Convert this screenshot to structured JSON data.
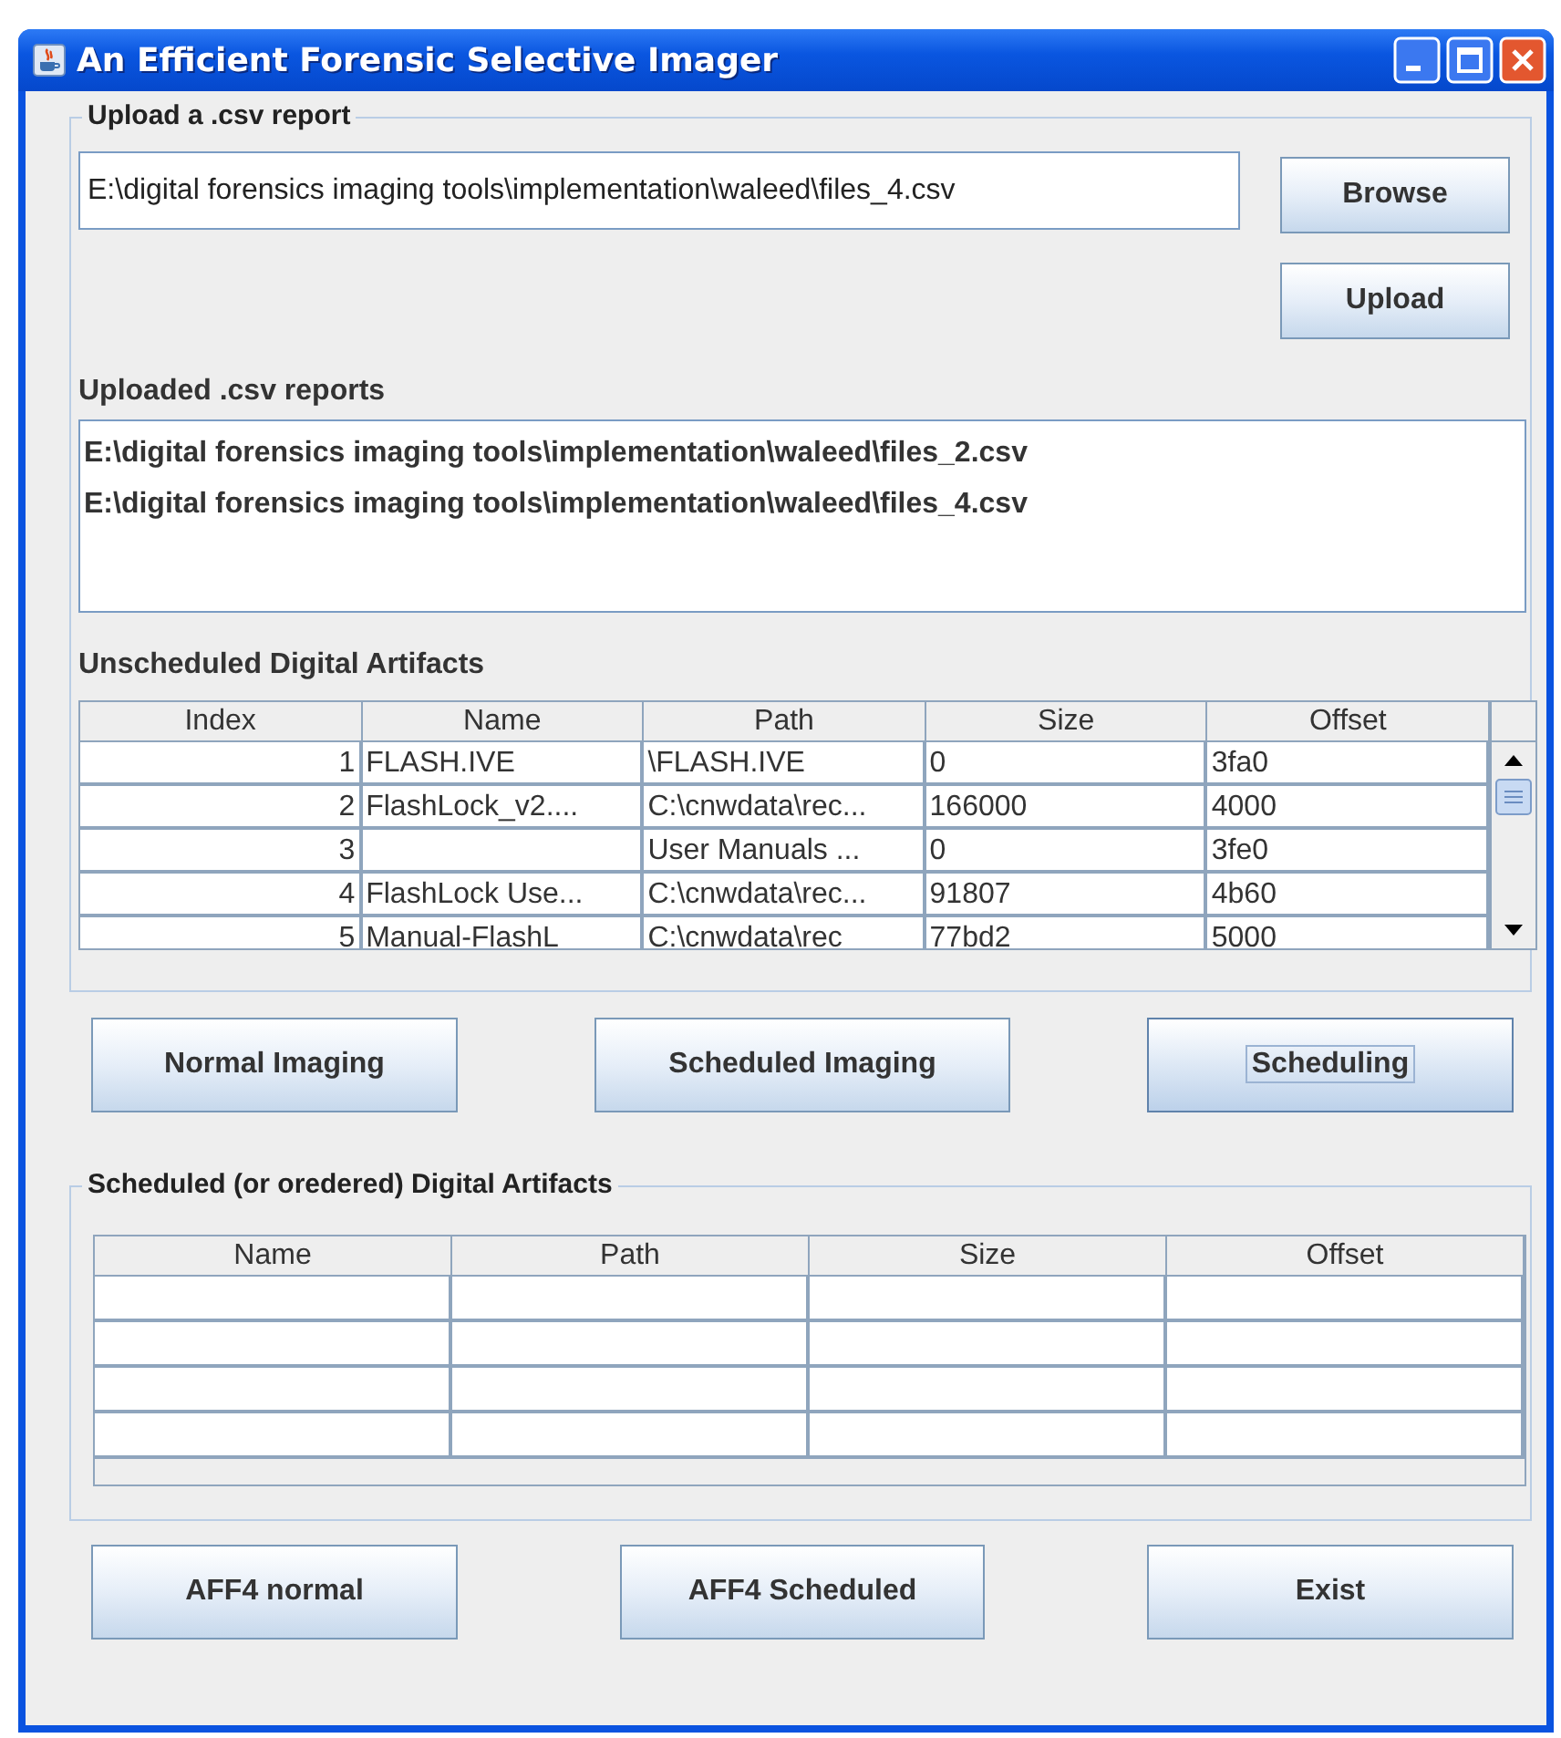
{
  "window": {
    "title": "An Efficient Forensic Selective Imager"
  },
  "upload": {
    "legend": "Upload a .csv report",
    "file_field": {
      "value": "E:\\digital forensics imaging tools\\implementation\\waleed\\files_4.csv"
    },
    "buttons": [
      {
        "label": "Browse"
      },
      {
        "label": "Upload"
      }
    ],
    "reports_label": "Uploaded .csv reports",
    "reports": [
      "E:\\digital forensics imaging tools\\implementation\\waleed\\files_2.csv",
      "E:\\digital forensics imaging tools\\implementation\\waleed\\files_4.csv"
    ],
    "unscheduled_label": "Unscheduled Digital Artifacts",
    "unscheduled_table": {
      "columns": [
        "Index",
        "Name",
        "Path",
        "Size",
        "Offset"
      ],
      "rows": [
        [
          "1",
          "FLASH.IVE",
          "\\FLASH.IVE",
          "0",
          "3fa0"
        ],
        [
          "2",
          "FlashLock_v2....",
          "C:\\cnwdata\\rec...",
          "166000",
          "4000"
        ],
        [
          "3",
          "",
          "User Manuals ...",
          "0",
          "3fe0"
        ],
        [
          "4",
          "FlashLock Use...",
          "C:\\cnwdata\\rec...",
          "91807",
          "4b60"
        ],
        [
          "5",
          "Manual-FlashL",
          "C:\\cnwdata\\rec",
          "77bd2",
          "5000"
        ]
      ]
    }
  },
  "actions": [
    {
      "label": "Normal Imaging",
      "focused": false
    },
    {
      "label": "Scheduled Imaging",
      "focused": false
    },
    {
      "label": "Scheduling",
      "focused": true
    }
  ],
  "scheduled": {
    "legend": "Scheduled (or oredered) Digital Artifacts",
    "table": {
      "columns": [
        "Name",
        "Path",
        "Size",
        "Offset"
      ]
    }
  },
  "bottom_buttons": [
    {
      "label": "AFF4 normal"
    },
    {
      "label": "AFF4 Scheduled"
    },
    {
      "label": "Exist"
    }
  ]
}
